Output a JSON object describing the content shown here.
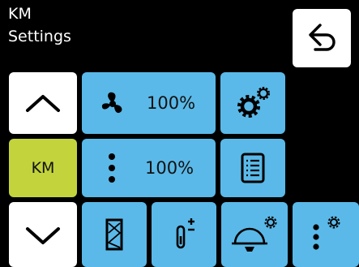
{
  "header": {
    "title_line1": "KM",
    "title_line2": "Settings",
    "back_icon": "back-arrow-icon"
  },
  "left_column": {
    "up_icon": "chevron-up-icon",
    "mode_label": "KM",
    "down_icon": "chevron-down-icon"
  },
  "row1": {
    "fan_icon": "fan-icon",
    "fan_value": "100%",
    "settings_icon": "gears-icon"
  },
  "row2": {
    "more_icon": "vertical-dots-icon",
    "more_value": "100%",
    "document_icon": "document-list-icon"
  },
  "row3": {
    "filter_icon": "filter-icon",
    "temperature_icon": "thermometer-plus-minus-icon",
    "lamp_settings_icon": "lamp-gear-icon",
    "dots_settings_icon": "dots-gear-icon"
  },
  "colors": {
    "accent_blue": "#5ab9e8",
    "accent_lime": "#c3d33c",
    "background": "#000000",
    "white": "#ffffff"
  }
}
